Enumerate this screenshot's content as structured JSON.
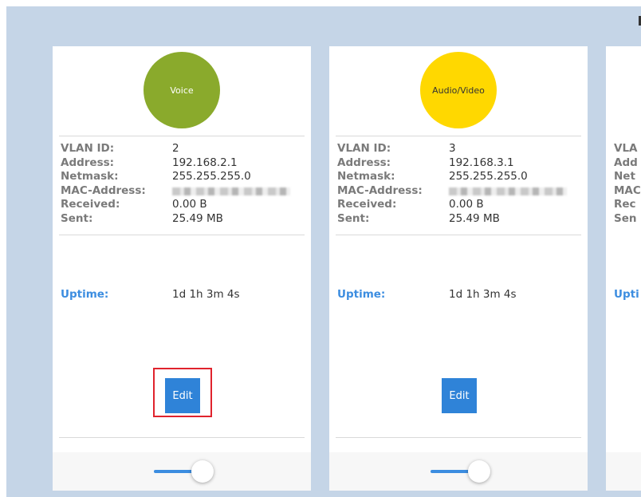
{
  "cards": [
    {
      "badge": "Voice",
      "badge_color": "#8aaa2c",
      "badge_text_color": "#ffffff",
      "labels": {
        "vlan_id": "VLAN ID:",
        "address": "Address:",
        "netmask": "Netmask:",
        "mac": "MAC-Address:",
        "received": "Received:",
        "sent": "Sent:",
        "uptime": "Uptime:"
      },
      "values": {
        "vlan_id": "2",
        "address": "192.168.2.1",
        "netmask": "255.255.255.0",
        "received": "0.00 B",
        "sent": "25.49 MB",
        "uptime": "1d 1h 3m 4s"
      },
      "edit_label": "Edit",
      "edit_highlighted": true
    },
    {
      "badge": "Audio/Video",
      "badge_color": "#ffd800",
      "badge_text_color": "#333333",
      "labels": {
        "vlan_id": "VLAN ID:",
        "address": "Address:",
        "netmask": "Netmask:",
        "mac": "MAC-Address:",
        "received": "Received:",
        "sent": "Sent:",
        "uptime": "Uptime:"
      },
      "values": {
        "vlan_id": "3",
        "address": "192.168.3.1",
        "netmask": "255.255.255.0",
        "received": "0.00 B",
        "sent": "25.49 MB",
        "uptime": "1d 1h 3m 4s"
      },
      "edit_label": "Edit",
      "edit_highlighted": false
    },
    {
      "labels_partial": {
        "vlan_id": "VLA",
        "address": "Add",
        "netmask": "Net",
        "mac": "MAC",
        "received": "Rec",
        "sent": "Sen",
        "uptime": "Upti"
      }
    }
  ],
  "colors": {
    "accent": "#3c8de0",
    "button": "#2f83d8",
    "highlight": "#e0232d",
    "background": "#c5d5e7"
  }
}
